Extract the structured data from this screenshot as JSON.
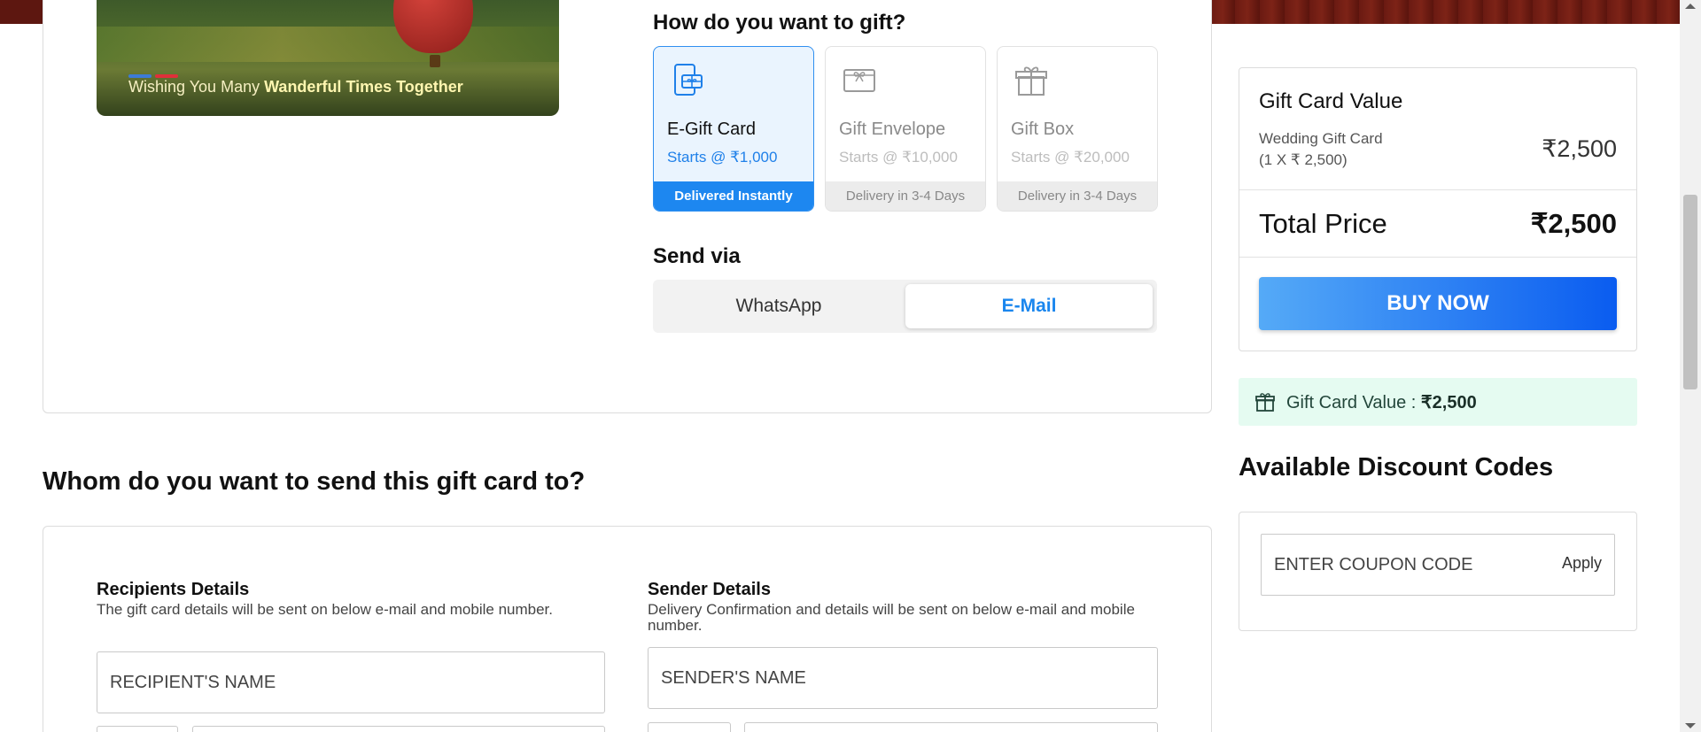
{
  "hero": {
    "caption_pre": "Wishing You Many",
    "caption_bold": "Wanderful Times Together"
  },
  "gift": {
    "heading": "How do you want to gift?",
    "options": [
      {
        "title": "E-Gift Card",
        "price": "Starts @ ₹1,000",
        "delivery": "Delivered Instantly",
        "icon": "mobile-gift-icon",
        "selected": true
      },
      {
        "title": "Gift Envelope",
        "price": "Starts @ ₹10,000",
        "delivery": "Delivery in 3-4 Days",
        "icon": "envelope-gift-icon",
        "selected": false
      },
      {
        "title": "Gift Box",
        "price": "Starts @ ₹20,000",
        "delivery": "Delivery in 3-4 Days",
        "icon": "gift-box-icon",
        "selected": false
      }
    ]
  },
  "send": {
    "heading": "Send via",
    "options": [
      "WhatsApp",
      "E-Mail"
    ],
    "selected": "E-Mail"
  },
  "whom": {
    "heading": "Whom do you want to send this gift card to?"
  },
  "recipient": {
    "title": "Recipients Details",
    "desc": "The gift card details will be sent on below e-mail and mobile number.",
    "name_placeholder": "RECIPIENT'S NAME"
  },
  "sender": {
    "title": "Sender Details",
    "desc": "Delivery Confirmation and details will be sent on below e-mail and mobile number.",
    "name_placeholder": "SENDER'S NAME"
  },
  "summary": {
    "title": "Gift Card Value",
    "item_name": "Wedding Gift Card",
    "item_qty": "(1 X ₹ 2,500)",
    "item_amount": "₹2,500",
    "total_label": "Total Price",
    "total_amount": "₹2,500",
    "buy_label": "BUY NOW"
  },
  "value_banner": {
    "label": "Gift Card Value :",
    "amount": "₹2,500"
  },
  "discount": {
    "heading": "Available Discount Codes",
    "placeholder": "ENTER COUPON CODE",
    "apply_label": "Apply"
  },
  "colors": {
    "accent": "#1d87f0",
    "banner_bg": "#e5fbf1"
  }
}
